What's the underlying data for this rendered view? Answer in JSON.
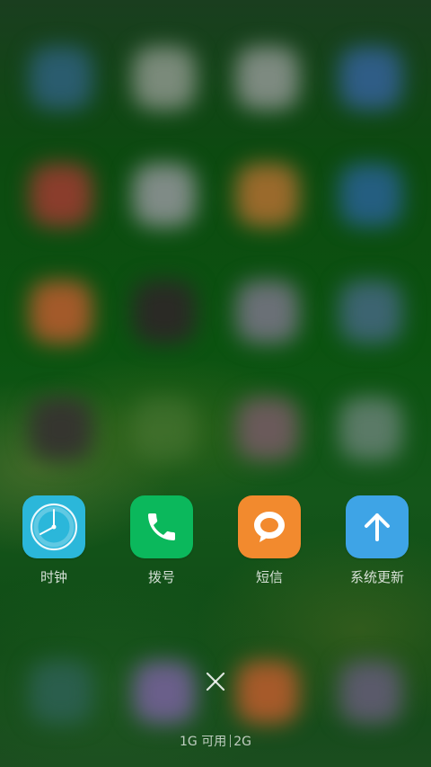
{
  "blurred_background": {
    "description_icons": [
      "blurred-app-icon"
    ]
  },
  "recent_apps": [
    {
      "label": "时钟",
      "icon": "clock-icon",
      "color": "#2BB7DA"
    },
    {
      "label": "拨号",
      "icon": "phone-icon",
      "color": "#0BB85C"
    },
    {
      "label": "短信",
      "icon": "message-icon",
      "color": "#F28A2E"
    },
    {
      "label": "系统更新",
      "icon": "arrow-up-icon",
      "color": "#3EA4E6"
    }
  ],
  "close_button": {
    "icon": "close-icon"
  },
  "memory": {
    "available": "1G 可用",
    "total": "2G"
  }
}
